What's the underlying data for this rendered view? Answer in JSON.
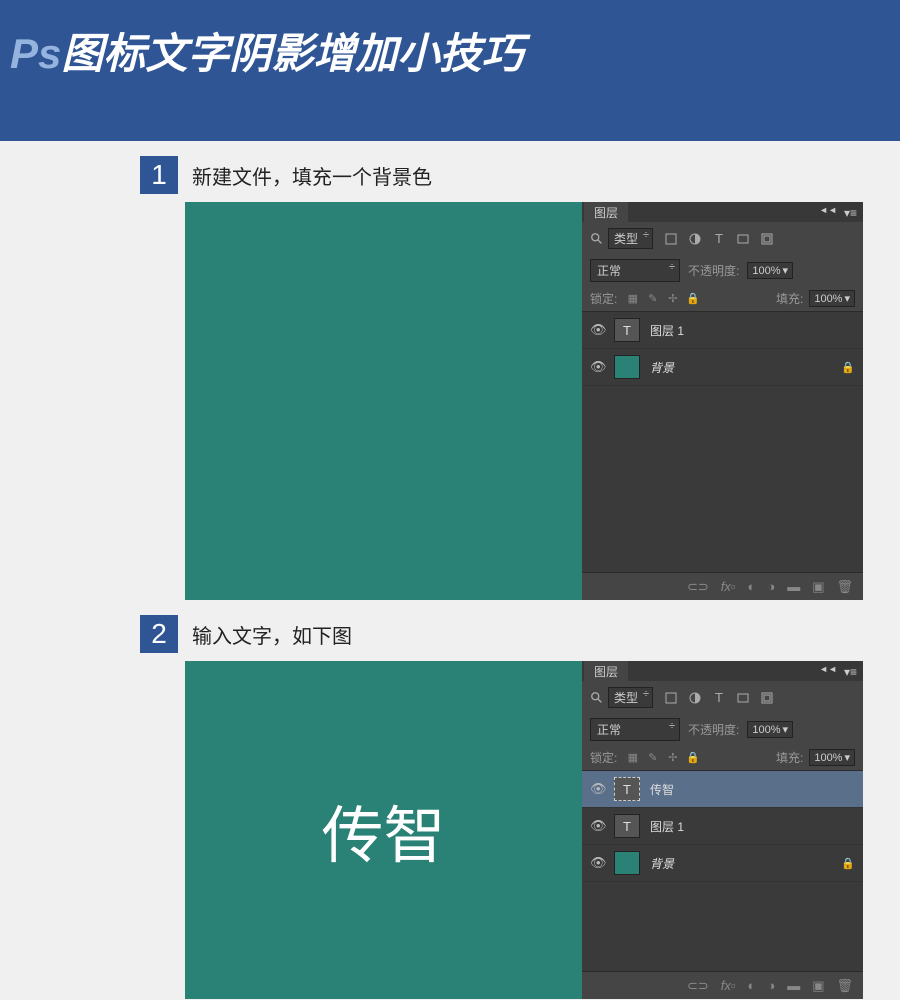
{
  "title_prefix": "Ps",
  "title_main": "图标文字阴影增加小技巧",
  "step1_num": "1",
  "step1_text": "新建文件，填充一个背景色",
  "step2_num": "2",
  "step2_text": "输入文字，如下图",
  "panel_tab": "图层",
  "type_label": "类型",
  "blend_mode": "正常",
  "opacity_label": "不透明度:",
  "opacity_value": "100%",
  "lock_label": "锁定:",
  "fill_label": "填充:",
  "fill_value": "100%",
  "layer1_name": "图层 1",
  "bg_layer_name": "背景",
  "text_layer_name": "传智",
  "canvas_text": "传智"
}
